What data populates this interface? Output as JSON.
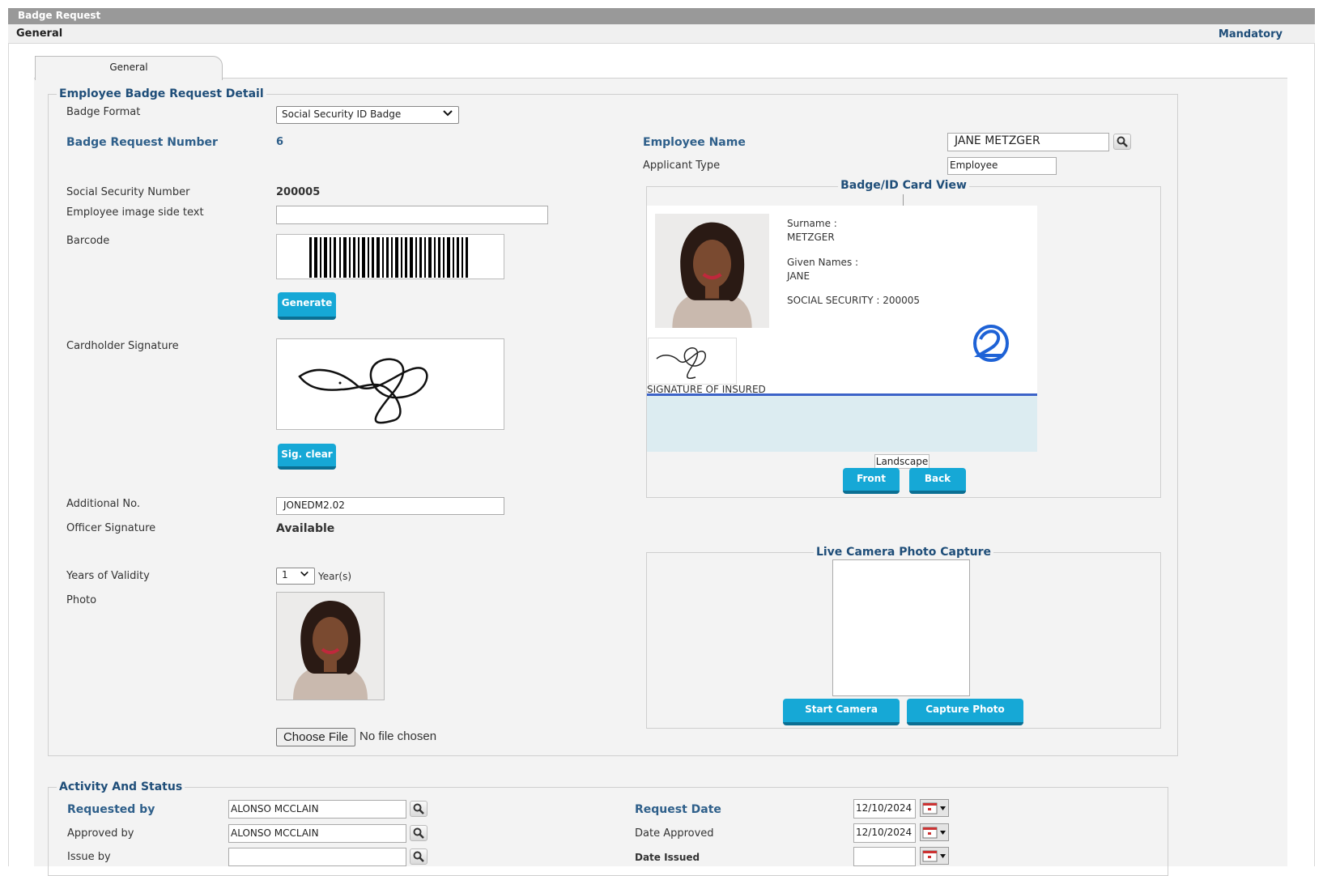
{
  "window": {
    "title": "Badge Request"
  },
  "subheader": {
    "section": "General",
    "mandatory_link": "Mandatory"
  },
  "tabs": [
    {
      "label": "General",
      "active": true
    }
  ],
  "badge_detail": {
    "legend": "Employee Badge Request Detail",
    "badge_format": {
      "label": "Badge Format",
      "value": "Social Security ID Badge"
    },
    "badge_request_number": {
      "label": "Badge Request Number",
      "value": "6"
    },
    "employee_name": {
      "label": "Employee Name",
      "value": "JANE METZGER"
    },
    "applicant_type": {
      "label": "Applicant Type",
      "value": "Employee"
    },
    "ssn": {
      "label": "Social Security Number",
      "value": "200005"
    },
    "image_side_text": {
      "label": "Employee image side text",
      "value": ""
    },
    "barcode": {
      "label": "Barcode",
      "generate_label": "Generate"
    },
    "signature": {
      "label": "Cardholder Signature",
      "clear_label": "Sig. clear"
    },
    "additional_no": {
      "label": "Additional No.",
      "value": "JONEDM2.02"
    },
    "officer_signature": {
      "label": "Officer Signature",
      "value": "Available"
    },
    "years_validity": {
      "label": "Years of Validity",
      "value": "1",
      "unit": "Year(s)"
    },
    "photo": {
      "label": "Photo",
      "choose_file": "Choose File",
      "file_status": "No file chosen"
    }
  },
  "card_view": {
    "legend": "Badge/ID Card View",
    "surname_label": "Surname :",
    "surname": "METZGER",
    "given_label": "Given Names :",
    "given": "JANE",
    "ss_line": "SOCIAL SECURITY : 200005",
    "signature_caption": "SIGNATURE OF INSURED",
    "orientation": "Landscape",
    "front_label": "Front",
    "back_label": "Back"
  },
  "camera": {
    "legend": "Live Camera Photo Capture",
    "start_label": "Start Camera",
    "capture_label": "Capture Photo"
  },
  "activity": {
    "legend": "Activity And Status",
    "requested_by": {
      "label": "Requested by",
      "value": "ALONSO MCCLAIN"
    },
    "approved_by": {
      "label": "Approved by",
      "value": "ALONSO MCCLAIN"
    },
    "issue_by": {
      "label": "Issue by",
      "value": ""
    },
    "request_date": {
      "label": "Request Date",
      "value": "12/10/2024"
    },
    "date_approved": {
      "label": "Date Approved",
      "value": "12/10/2024"
    },
    "date_issued": {
      "label": "Date Issued",
      "value": ""
    }
  },
  "colors": {
    "accent": "#16a8d6",
    "heading": "#1f4e79",
    "titlebar": "#999999"
  },
  "icons": [
    "search-icon",
    "calendar-icon",
    "chevron-down-icon"
  ]
}
